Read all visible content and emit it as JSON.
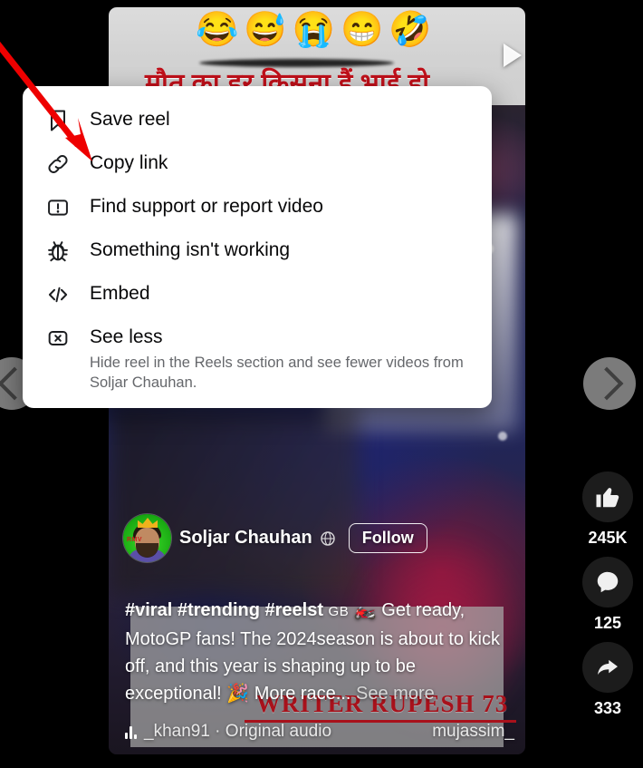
{
  "video": {
    "hindi_overlay": "मौत का हर किसना हैं भाई हो",
    "emojis": [
      "😂",
      "😅",
      "😭",
      "😁",
      "🤣"
    ],
    "watermark": "WRITER  RUPESH  73",
    "controls": {
      "play": "play-icon",
      "volume": "volume-icon",
      "more": "more-options-icon"
    }
  },
  "author": {
    "name": "Soljar Chauhan",
    "privacy_icon": "globe-icon",
    "follow_label": "Follow"
  },
  "caption": {
    "hashtags": "#viral #trending #reelst",
    "small_caps": "GB",
    "emoji_bike": "🏍️",
    "line1": " Get ready,",
    "body": "MotoGP fans! The 2024season is about to kick off, and this year is shaping up to be exceptional! ",
    "emoji_party": "🎉",
    "tail": " More race...",
    "see_more": "See more"
  },
  "audio": {
    "icon": "audio-wave-icon",
    "title": "_khan91 · Original audio",
    "right_label": "mujassim_"
  },
  "actions": [
    {
      "name": "like",
      "icon": "thumbs-up-icon",
      "count": "245K"
    },
    {
      "name": "comment",
      "icon": "comment-bubble-icon",
      "count": "125"
    },
    {
      "name": "share",
      "icon": "share-arrow-icon",
      "count": "333"
    }
  ],
  "nav": {
    "prev_icon": "chevron-left-icon",
    "next_icon": "chevron-right-icon"
  },
  "menu": {
    "items": [
      {
        "icon": "bookmark-icon",
        "label": "Save reel",
        "sub": ""
      },
      {
        "icon": "link-icon",
        "label": "Copy link",
        "sub": ""
      },
      {
        "icon": "exclamation-box-icon",
        "label": "Find support or report video",
        "sub": ""
      },
      {
        "icon": "bug-icon",
        "label": "Something isn't working",
        "sub": ""
      },
      {
        "icon": "code-brackets-icon",
        "label": "Embed",
        "sub": ""
      },
      {
        "icon": "close-box-icon",
        "label": "See less",
        "sub": "Hide reel in the Reels section and see fewer videos from Soljar Chauhan."
      }
    ]
  },
  "annotation": {
    "arrow_color": "#ee0000",
    "points_to": "Copy link"
  }
}
